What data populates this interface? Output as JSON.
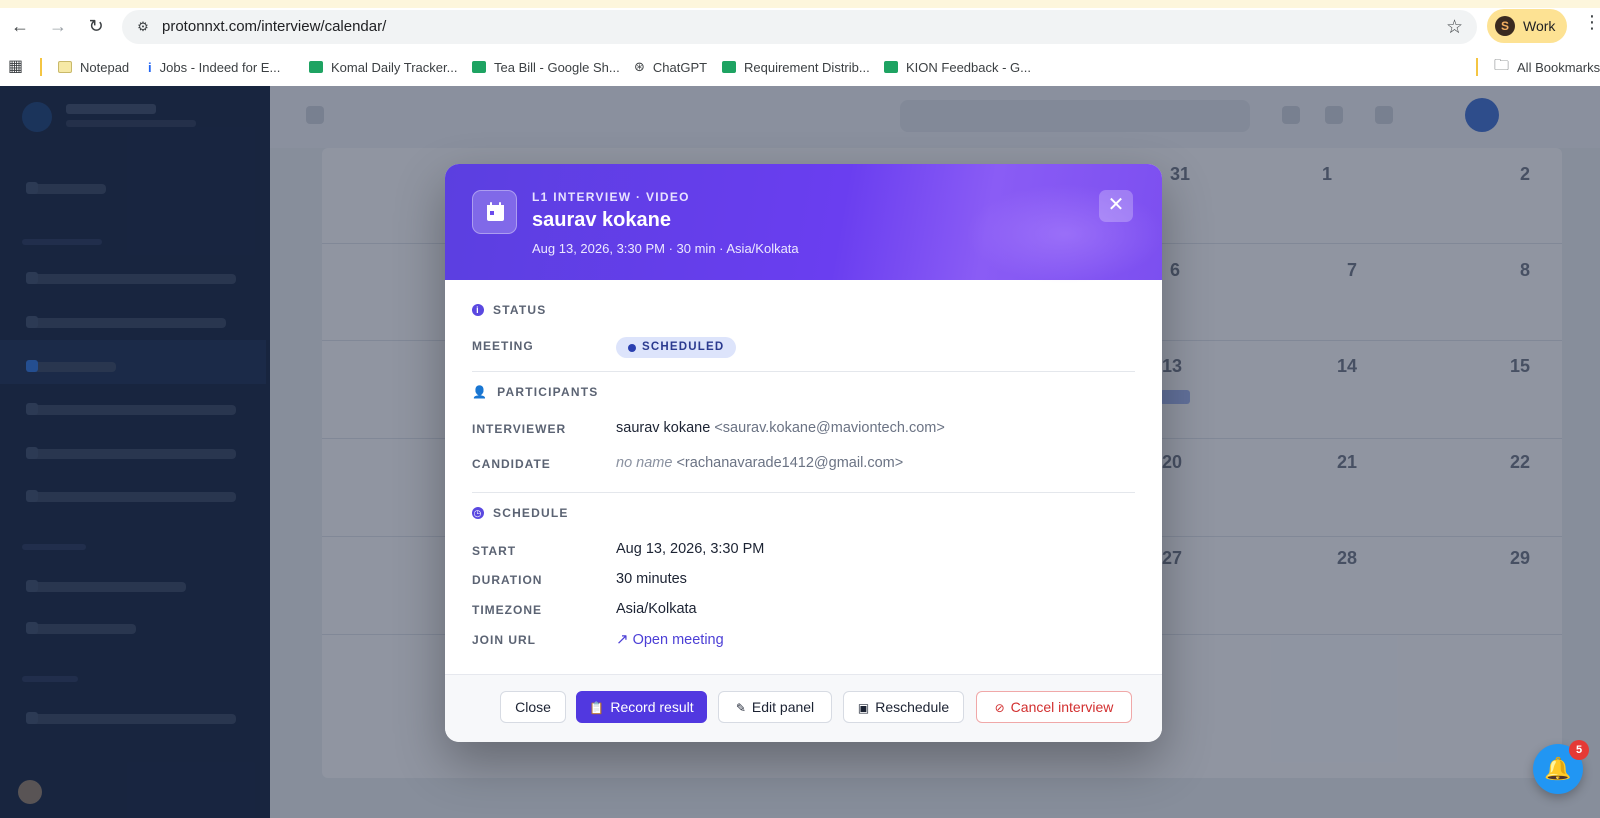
{
  "browser": {
    "url": "protonnxt.com/interview/calendar/",
    "profile_label": "Work",
    "profile_initial": "S",
    "bookmarks": [
      {
        "label": "Notepad"
      },
      {
        "label": "Jobs - Indeed for E..."
      },
      {
        "label": "Komal Daily Tracker..."
      },
      {
        "label": "Tea Bill - Google Sh..."
      },
      {
        "label": "ChatGPT"
      },
      {
        "label": "Requirement Distrib..."
      },
      {
        "label": "KION Feedback - G..."
      }
    ],
    "all_bookmarks_label": "All Bookmarks"
  },
  "modal": {
    "eyebrow": "L1 INTERVIEW · VIDEO",
    "title": "saurav kokane",
    "subtitle": "Aug 13, 2026, 3:30 PM · 30 min · Asia/Kolkata",
    "close_glyph": "✕",
    "status": {
      "heading": "STATUS",
      "meeting_label": "MEETING",
      "meeting_value": "SCHEDULED"
    },
    "participants": {
      "heading": "PARTICIPANTS",
      "interviewer_label": "INTERVIEWER",
      "interviewer_name": "saurav kokane",
      "interviewer_email": "<saurav.kokane@maviontech.com>",
      "candidate_label": "CANDIDATE",
      "candidate_name": "no name",
      "candidate_email": "<rachanavarade1412@gmail.com>"
    },
    "schedule": {
      "heading": "SCHEDULE",
      "start_label": "START",
      "start_value": "Aug 13, 2026, 3:30 PM",
      "duration_label": "DURATION",
      "duration_value": "30 minutes",
      "timezone_label": "TIMEZONE",
      "timezone_value": "Asia/Kolkata",
      "join_label": "JOIN URL",
      "join_value": "Open meeting"
    },
    "footer": {
      "close": "Close",
      "record": "Record result",
      "edit": "Edit panel",
      "reschedule": "Reschedule",
      "cancel": "Cancel interview"
    }
  },
  "calendar_background": {
    "day_numbers": [
      "31",
      "1",
      "2",
      "6",
      "7",
      "8",
      "13",
      "14",
      "15",
      "20",
      "21",
      "22",
      "27",
      "28",
      "29"
    ]
  },
  "notifications": {
    "count": "5"
  },
  "colors": {
    "accent": "#5138e0",
    "header_gradient_start": "#5b3fe0",
    "header_gradient_end": "#8a5cf5",
    "danger": "#d22f2f",
    "bell": "#2196f3"
  }
}
